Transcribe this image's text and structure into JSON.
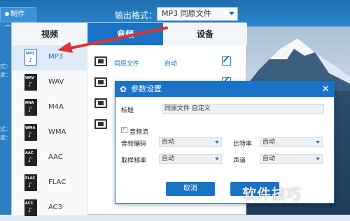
{
  "toolbar": {
    "gif_button": "制作GIF",
    "format_label": "输出格式：",
    "format_value": "MP3  同原文件"
  },
  "left_strip": [
    "式：",
    "度：",
    "式：",
    "度："
  ],
  "tabs": [
    "视频",
    "音频",
    "设备"
  ],
  "formats": [
    {
      "name": "MP3",
      "tag": "MP3",
      "selected": true
    },
    {
      "name": "WAV",
      "tag": "WAV",
      "selected": false
    },
    {
      "name": "M4A",
      "tag": "M4A",
      "selected": false
    },
    {
      "name": "WMA",
      "tag": "WMA",
      "selected": false
    },
    {
      "name": "AAC",
      "tag": "AAC",
      "selected": false
    },
    {
      "name": "FLAC",
      "tag": "FLAC",
      "selected": false
    },
    {
      "name": "AC3",
      "tag": "AC3",
      "selected": false
    }
  ],
  "presets": [
    {
      "name": "同原文件",
      "value": "自动"
    },
    {
      "name": "",
      "value": ""
    },
    {
      "name": "",
      "value": ""
    },
    {
      "name": "",
      "value": ""
    }
  ],
  "dialog": {
    "title": "参数设置",
    "close": "✕",
    "title_label": "标题",
    "title_value": "同原文件 自定义",
    "audio_stream_label": "音频流",
    "codec_label": "音频编码",
    "codec_value": "自动",
    "bitrate_label": "比特率",
    "bitrate_value": "自动",
    "samplerate_label": "取样频率",
    "samplerate_value": "自动",
    "channel_label": "声道",
    "channel_value": "自动",
    "cancel": "取消"
  },
  "watermark": "软件技巧",
  "colors": {
    "accent": "#1a73c6",
    "arrow": "#e0322e"
  }
}
